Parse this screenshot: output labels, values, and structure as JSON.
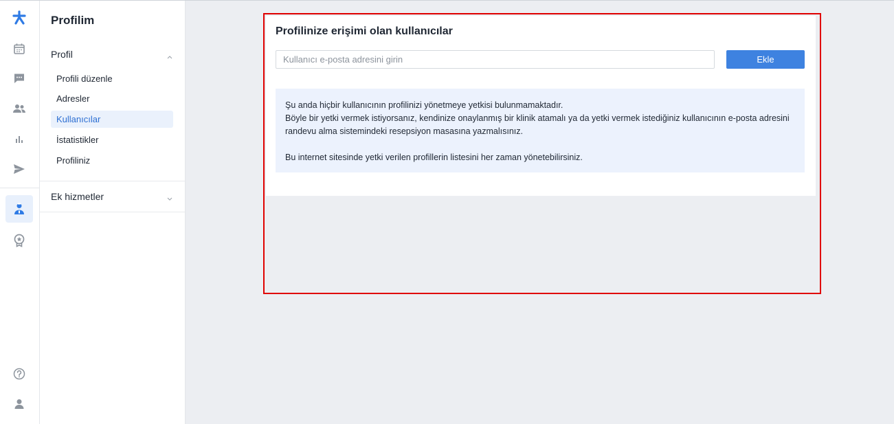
{
  "rail": {
    "icons": [
      "logo-icon",
      "calendar-icon",
      "chat-icon",
      "users-icon",
      "stats-icon",
      "send-icon",
      "doctor-icon",
      "badge-icon",
      "help-icon",
      "user-icon"
    ]
  },
  "sidebar": {
    "title": "Profilim",
    "sections": [
      {
        "label": "Profil",
        "expanded": true,
        "items": [
          {
            "label": "Profili düzenle"
          },
          {
            "label": "Adresler"
          },
          {
            "label": "Kullanıcılar",
            "active": true
          },
          {
            "label": "İstatistikler"
          },
          {
            "label": "Profiliniz"
          }
        ]
      },
      {
        "label": "Ek hizmetler",
        "expanded": false
      }
    ]
  },
  "main": {
    "title": "Profilinize erişimi olan kullanıcılar",
    "email_input": {
      "placeholder": "Kullanıcı e-posta adresini girin",
      "value": ""
    },
    "add_button": "Ekle",
    "info": {
      "line1": "Şu anda hiçbir kullanıcının profilinizi yönetmeye yetkisi bulunmamaktadır.",
      "line2": "Böyle bir yetki vermek istiyorsanız, kendinize onaylanmış bir klinik atamalı ya da yetki vermek istediğiniz kullanıcının e-posta adresini randevu alma sistemindeki resepsiyon masasına yazmalısınız.",
      "line3": "Bu internet sitesinde yetki verilen profillerin listesini her zaman yönetebilirsiniz."
    }
  },
  "colors": {
    "accent": "#3e82e0",
    "active_bg": "#eaf1fc",
    "info_bg": "#ecf2fd",
    "highlight_frame": "#e00000",
    "page_bg": "#eceef2"
  }
}
